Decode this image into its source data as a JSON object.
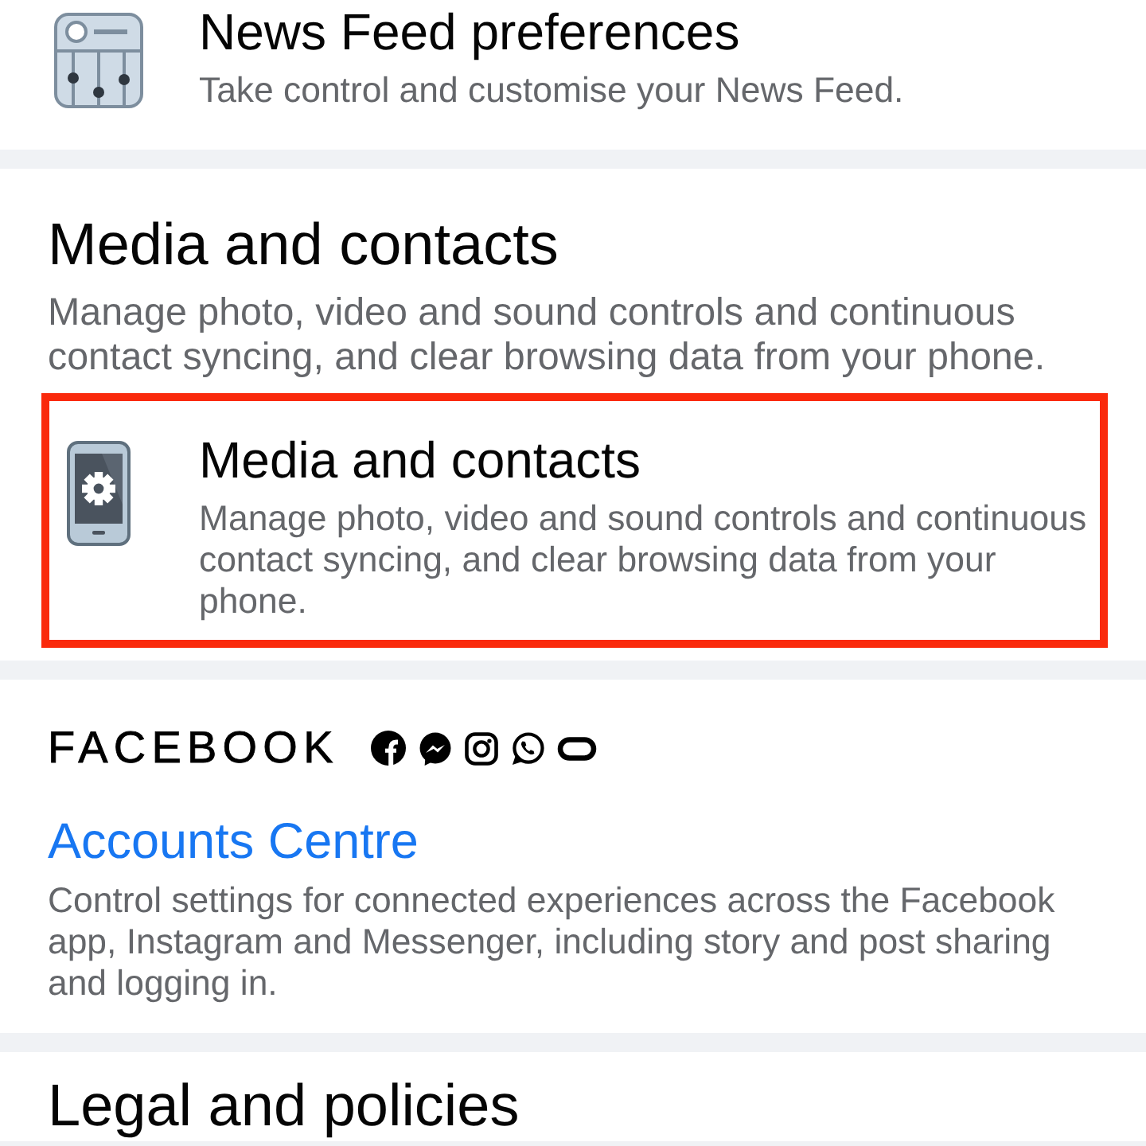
{
  "sections": [
    {
      "kind": "list",
      "items": [
        {
          "title": "News Feed preferences",
          "description": "Take control and customise your News Feed.",
          "highlighted": false
        }
      ]
    },
    {
      "kind": "list",
      "title": "Media and contacts",
      "description": "Manage photo, video and sound controls and continuous contact syncing, and clear browsing data from your phone.",
      "items": [
        {
          "title": "Media and contacts",
          "description": "Manage photo, video and sound controls and continuous contact syncing, and clear browsing data from your phone.",
          "highlighted": true
        }
      ]
    },
    {
      "kind": "brand",
      "brand": "FACEBOOK",
      "link": "Accounts Centre",
      "description": "Control settings for connected experiences across the Facebook app, Instagram and Messenger, including story and post sharing and logging in."
    },
    {
      "kind": "list",
      "title": "Legal and policies"
    }
  ]
}
